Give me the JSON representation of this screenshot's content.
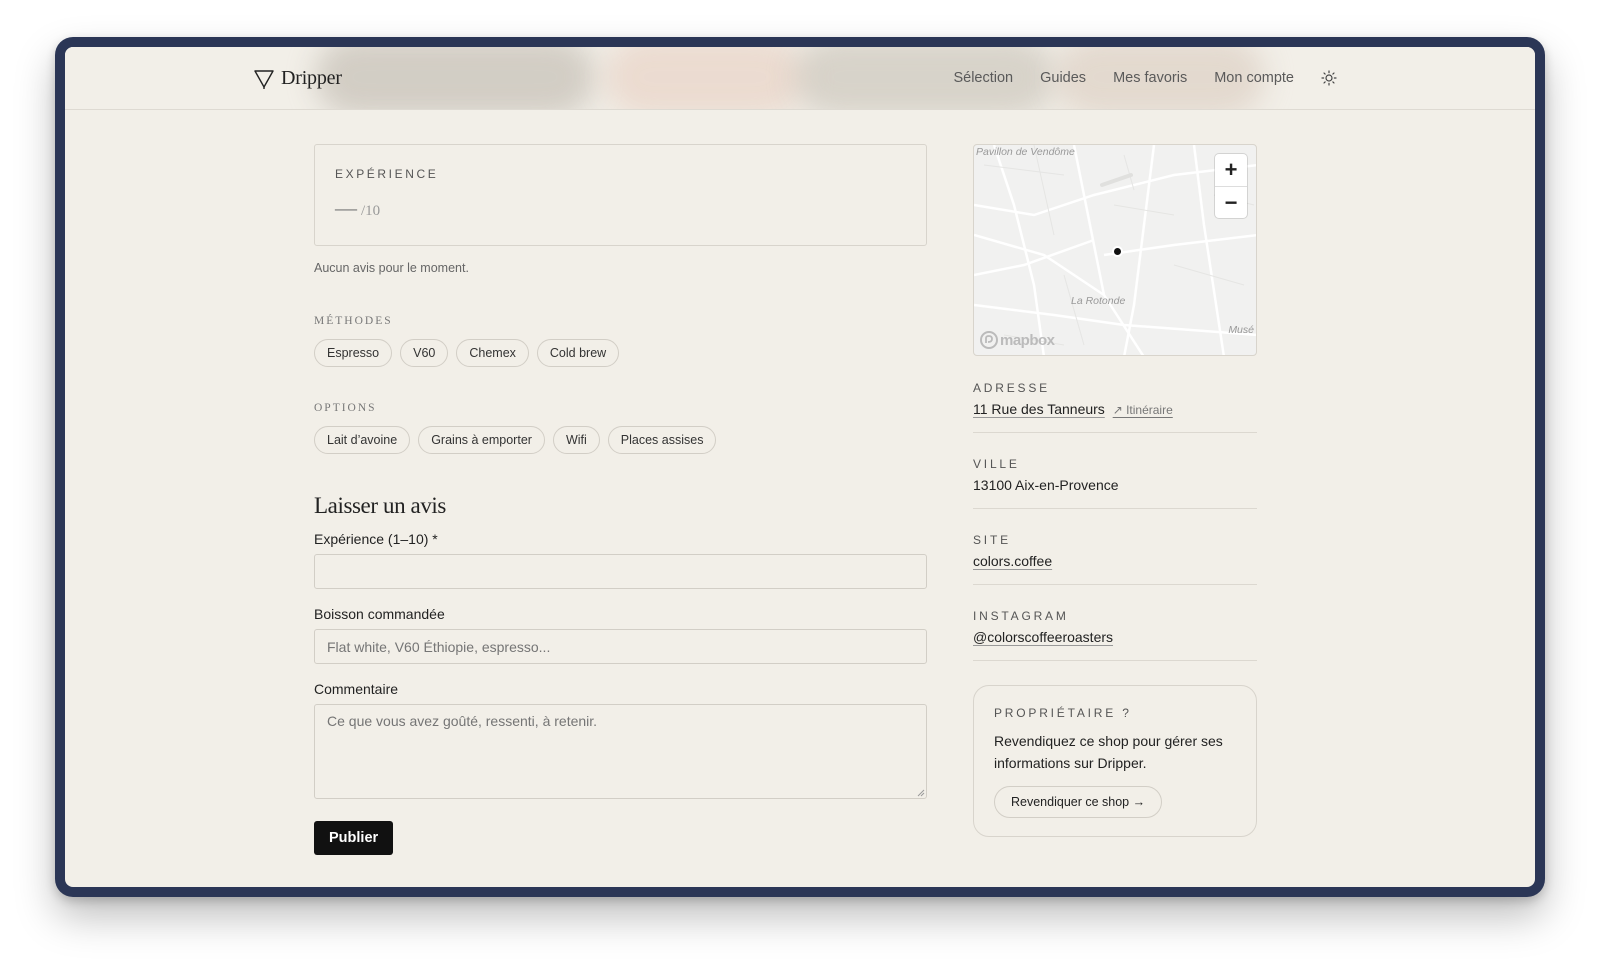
{
  "brand": {
    "name": "Dripper"
  },
  "nav": {
    "items": [
      "Sélection",
      "Guides",
      "Mes favoris",
      "Mon compte"
    ]
  },
  "experience": {
    "label": "EXPÉRIENCE",
    "score": "—",
    "out_of": "/10",
    "no_reviews": "Aucun avis pour le moment."
  },
  "methods": {
    "label": "MÉTHODES",
    "items": [
      "Espresso",
      "V60",
      "Chemex",
      "Cold brew"
    ]
  },
  "options": {
    "label": "OPTIONS",
    "items": [
      "Lait d’avoine",
      "Grains à emporter",
      "Wifi",
      "Places assises"
    ]
  },
  "review_form": {
    "title": "Laisser un avis",
    "experience_label": "Expérience (1–10) *",
    "experience_value": "",
    "drink_label": "Boisson commandée",
    "drink_placeholder": "Flat white, V60 Éthiopie, espresso...",
    "comment_label": "Commentaire",
    "comment_placeholder": "Ce que vous avez goûté, ressenti, à retenir.",
    "submit": "Publier"
  },
  "map": {
    "labels": {
      "top": "Pavillon de Vendôme",
      "center": "La Rotonde",
      "right": "Musé"
    },
    "zoom_in": "+",
    "zoom_out": "−",
    "attribution": "mapbox"
  },
  "details": {
    "address_label": "ADRESSE",
    "address_value": "11 Rue des Tanneurs",
    "itinerary": "↗ Itinéraire",
    "city_label": "VILLE",
    "city_value": "13100 Aix-en-Provence",
    "site_label": "SITE",
    "site_value": "colors.coffee",
    "instagram_label": "INSTAGRAM",
    "instagram_value": "@colorscoffeeroasters"
  },
  "owner": {
    "label": "PROPRIÉTAIRE ?",
    "text": "Revendiquez ce shop pour gérer ses informations sur Dripper.",
    "button": "Revendiquer ce shop →"
  },
  "colors": {
    "page_bg": "#f2efe8",
    "frame": "#2b3656",
    "primary_button": "#111111"
  }
}
